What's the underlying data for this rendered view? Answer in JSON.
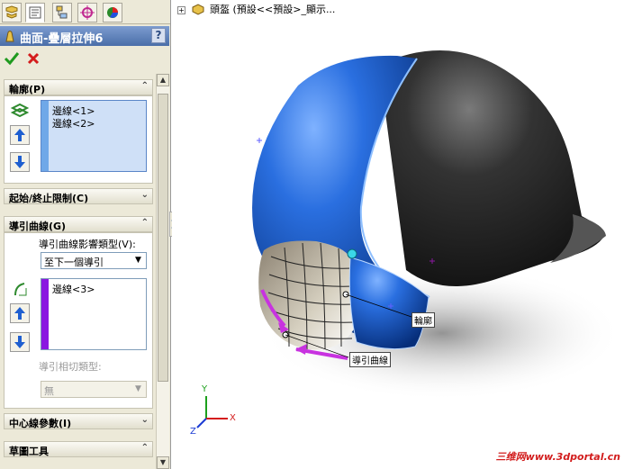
{
  "panel": {
    "title": "曲面-疊層拉伸6",
    "help_label": "?",
    "tabs": [
      {
        "icon": "feature-manager-icon"
      },
      {
        "icon": "property-manager-icon"
      },
      {
        "icon": "configuration-manager-icon"
      },
      {
        "icon": "dimxpert-icon"
      },
      {
        "icon": "display-manager-icon"
      }
    ],
    "ok_icon": "checkmark-icon",
    "cancel_icon": "x-icon",
    "sections": {
      "profile": {
        "title": "輪廓(P)",
        "items": [
          "邊線<1>",
          "邊線<2>"
        ]
      },
      "start_end": {
        "title": "起始/終止限制(C)"
      },
      "guides": {
        "title": "導引曲線(G)",
        "influence_label": "導引曲線影響類型(V):",
        "influence_value": "至下一個導引",
        "items": [
          "邊線<3>"
        ],
        "tangency_label": "導引相切類型:",
        "tangency_value": "無"
      },
      "centerline": {
        "title": "中心線參數(I)"
      },
      "sketch_tools": {
        "title": "草圖工具"
      }
    }
  },
  "viewport": {
    "tree_label": "頭盔 (預設<<預設>_顯示...",
    "callout_profile": "輪廓",
    "callout_guide": "導引曲線",
    "triad": {
      "x": "X",
      "y": "Y",
      "z": "Z"
    },
    "watermark": "三维网www.3dportal.cn"
  },
  "colors": {
    "panel_bg": "#ece9d8",
    "title_bar": "#4a6ea8",
    "helmet_blue": "#1a5fc8",
    "helmet_black": "#2a2a2a",
    "guide_magenta": "#c832e0",
    "profile_listbar": "#6fa8e8",
    "guide_listbar": "#8a18e0"
  }
}
